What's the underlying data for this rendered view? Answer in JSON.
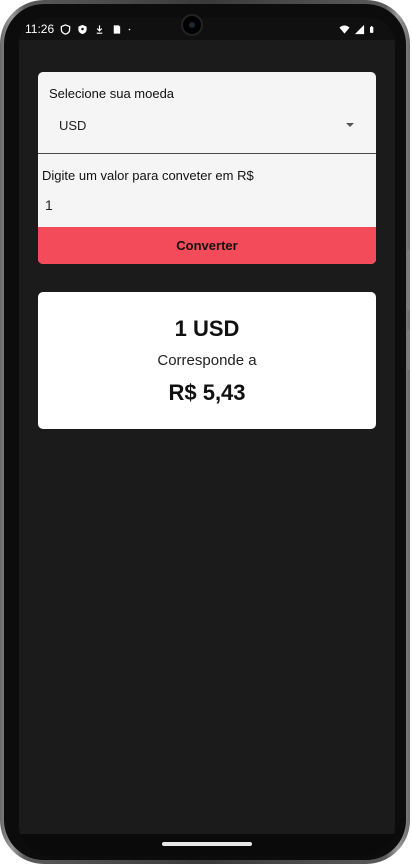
{
  "status_bar": {
    "time": "11:26",
    "left_icons": [
      "shield-icon",
      "vpn-key-icon",
      "download-icon",
      "sd-card-icon",
      "dot-icon"
    ],
    "right_icons": [
      "wifi-icon",
      "signal-icon",
      "battery-icon"
    ]
  },
  "currency_select": {
    "label": "Selecione sua moeda",
    "selected": "USD"
  },
  "amount_input": {
    "label": "Digite um valor para conveter em R$",
    "value": "1"
  },
  "convert_button": {
    "label": "Converter"
  },
  "result": {
    "amount": "1 USD",
    "caption": "Corresponde a",
    "value": "R$ 5,43"
  },
  "colors": {
    "background": "#1b1b1b",
    "card": "#f5f5f5",
    "accent": "#f34b59"
  }
}
